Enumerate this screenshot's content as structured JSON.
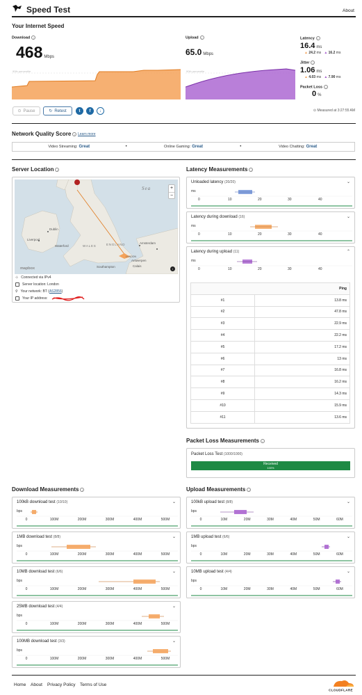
{
  "header": {
    "title": "Speed Test",
    "about": "About"
  },
  "speed": {
    "section_title": "Your Internet Speed",
    "download": {
      "label": "Download",
      "value": "468",
      "unit": "Mbps",
      "percentile": "90th percentile"
    },
    "upload": {
      "label": "Upload",
      "value": "65.0",
      "unit": "Mbps",
      "percentile": "90th percentile"
    },
    "latency": {
      "label": "Latency",
      "value": "16.4",
      "unit": "ms",
      "down": "24.2",
      "up": "16.2",
      "sub_unit": "ms"
    },
    "jitter": {
      "label": "Jitter",
      "value": "1.06",
      "unit": "ms",
      "down": "4.03",
      "up": "7.90",
      "sub_unit": "ms"
    },
    "packet_loss": {
      "label": "Packet Loss",
      "value": "0",
      "unit": "%"
    },
    "buttons": {
      "pause": "Pause",
      "retest": "Retest"
    },
    "measured": "Measured at 3:27:55 AM",
    "colors": {
      "download": "#f4a259",
      "upload": "#a85fcf",
      "link": "#2b5c8a",
      "good": "#1e8a44"
    }
  },
  "nq": {
    "title": "Network Quality Score",
    "learn_more": "Learn more",
    "items": [
      {
        "label": "Video Streaming:",
        "value": "Great"
      },
      {
        "label": "Online Gaming:",
        "value": "Great"
      },
      {
        "label": "Video Chatting:",
        "value": "Great"
      }
    ]
  },
  "server": {
    "title": "Server Location",
    "map_labels": {
      "sea": "Sea",
      "dublin": "Dublin",
      "liverpool": "Liverpool",
      "waterford": "Waterford",
      "wales": "WALES",
      "england": "ENGLAND",
      "london": "LONDON",
      "amsterdam": "Amsterdam",
      "antwerp": "Antwerpen",
      "southampton": "Southampton",
      "calais": "Calais",
      "mapbox": "mapbox",
      "zoom_in": "+",
      "zoom_out": "−"
    },
    "connected": "Connected via IPv4",
    "location": "Server location: London",
    "network_prefix": "Your network: BT (",
    "network_as": "AS2856",
    "network_suffix": ")",
    "ip_label": "Your IP address:"
  },
  "latency_meas": {
    "title": "Latency Measurements",
    "cards": [
      {
        "title": "Unloaded latency",
        "count": "(20/20)",
        "unit": "ms",
        "ticks": [
          "0",
          "10",
          "20",
          "30",
          "40"
        ]
      },
      {
        "title": "Latency during download",
        "count": "(16)",
        "unit": "ms",
        "ticks": [
          "0",
          "10",
          "20",
          "30",
          "40"
        ]
      },
      {
        "title": "Latency during upload",
        "count": "(11)",
        "unit": "ms",
        "ticks": [
          "0",
          "10",
          "20",
          "30",
          "40"
        ]
      }
    ],
    "table": {
      "header": "Ping",
      "rows": [
        {
          "n": "#1",
          "v": "13.8 ms"
        },
        {
          "n": "#2",
          "v": "47.8 ms"
        },
        {
          "n": "#3",
          "v": "22.9 ms"
        },
        {
          "n": "#4",
          "v": "22.2 ms"
        },
        {
          "n": "#5",
          "v": "17.2 ms"
        },
        {
          "n": "#6",
          "v": "13 ms"
        },
        {
          "n": "#7",
          "v": "16.8 ms"
        },
        {
          "n": "#8",
          "v": "16.2 ms"
        },
        {
          "n": "#9",
          "v": "14.3 ms"
        },
        {
          "n": "#10",
          "v": "15.9 ms"
        },
        {
          "n": "#11",
          "v": "13.6 ms"
        }
      ]
    }
  },
  "packet": {
    "title": "Packet Loss Measurements",
    "card_title": "Packet Loss Test",
    "count": "(1000/1000)",
    "bar_label": "Received",
    "bar_pct": "100%",
    "received_fraction": 1.0
  },
  "download_meas": {
    "title": "Download Measurements",
    "cards": [
      {
        "title": "100kB download test",
        "count": "(10/10)"
      },
      {
        "title": "1MB download test",
        "count": "(8/8)"
      },
      {
        "title": "10MB download test",
        "count": "(6/6)"
      },
      {
        "title": "25MB download test",
        "count": "(4/4)"
      },
      {
        "title": "100MB download test",
        "count": "(3/3)"
      }
    ],
    "unit": "bps",
    "ticks": [
      "0",
      "100M",
      "200M",
      "300M",
      "400M",
      "500M"
    ]
  },
  "upload_meas": {
    "title": "Upload Measurements",
    "cards": [
      {
        "title": "100kB upload test",
        "count": "(8/8)"
      },
      {
        "title": "1MB upload test",
        "count": "(6/6)"
      },
      {
        "title": "10MB upload test",
        "count": "(4/4)"
      }
    ],
    "unit": "bps",
    "ticks": [
      "0",
      "10M",
      "20M",
      "30M",
      "40M",
      "50M",
      "60M"
    ]
  },
  "footer": {
    "links": [
      "Home",
      "About",
      "Privacy Policy",
      "Terms of Use"
    ],
    "brand": "CLOUDFLARE"
  }
}
